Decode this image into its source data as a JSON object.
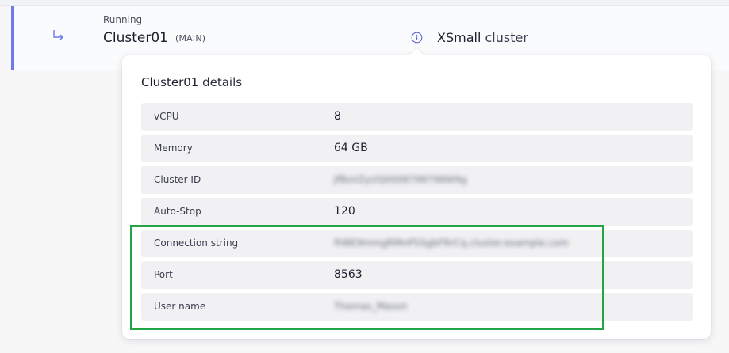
{
  "cluster": {
    "status": "Running",
    "name": "Cluster01",
    "tag": "(MAIN)",
    "size_strong": "XSmall",
    "size_rest": " cluster"
  },
  "popover": {
    "title_name": "Cluster01",
    "title_rest": " details",
    "rows": [
      {
        "label": "vCPU",
        "value": "8"
      },
      {
        "label": "Memory",
        "value": "64 GB"
      },
      {
        "label": "Cluster ID",
        "value": "JfBsVZyUQ0008798798W9g"
      },
      {
        "label": "Auto-Stop",
        "value": "120"
      },
      {
        "label": "Connection string",
        "value": "fH8E9mmgRMnP5SgbFRrCq.cluster.example.com"
      },
      {
        "label": "Port",
        "value": "8563"
      },
      {
        "label": "User name",
        "value": "Thomas_Mason"
      }
    ]
  },
  "colors": {
    "accent": "#6d78f2",
    "highlight": "#22a447"
  },
  "icons": {
    "branch": "branch-arrow-icon",
    "info": "info-icon"
  }
}
